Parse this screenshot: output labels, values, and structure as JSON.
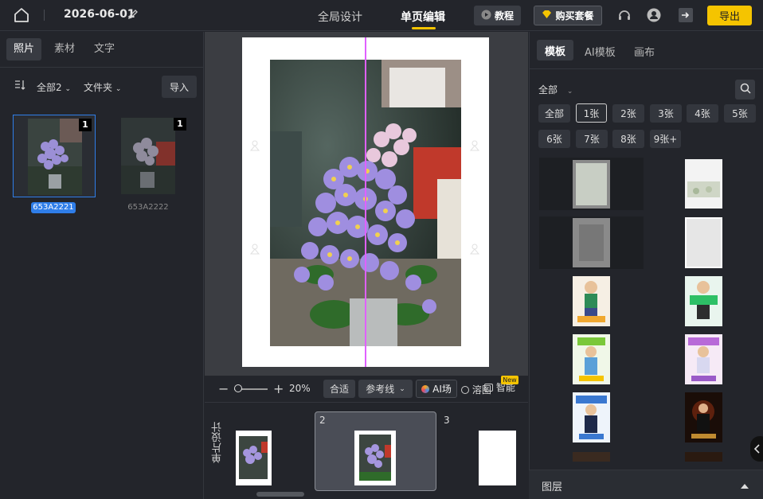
{
  "header": {
    "date": "2026-06-01",
    "tabs": [
      "全局设计",
      "单页编辑"
    ],
    "active_tab": "单页编辑",
    "tutorial_label": "教程",
    "buy_label": "购买套餐",
    "export_label": "导出"
  },
  "left_panel": {
    "tabs": [
      "照片",
      "素材",
      "文字"
    ],
    "active_tab": "照片",
    "filter_all": "全部2",
    "filter_folder": "文件夹",
    "import_label": "导入",
    "photos": [
      {
        "name": "653A2221",
        "count": "1",
        "selected": true
      },
      {
        "name": "653A2222",
        "count": "1",
        "selected": false
      }
    ]
  },
  "toolbar": {
    "zoom": "20%",
    "fit_label": "合适",
    "ref_label": "参考线",
    "ai_label": "AI场",
    "dissolve_label": "溶图",
    "smart_label": "智能",
    "new_badge": "New"
  },
  "pagestrip": {
    "label": "单片设计",
    "pages": [
      "2",
      "3"
    ]
  },
  "right_panel": {
    "tabs": [
      "模板",
      "AI模板",
      "画布"
    ],
    "active_tab": "模板",
    "filter_all": "全部",
    "count_chips": [
      "全部",
      "1张",
      "2张",
      "3张",
      "4张",
      "5张",
      "6张",
      "7张",
      "8张",
      "9张+"
    ],
    "selected_chip": "1张",
    "layers_label": "图层"
  },
  "colors": {
    "accent": "#f5c400",
    "selection": "#2f7ee9",
    "guide": "#e060ff"
  }
}
